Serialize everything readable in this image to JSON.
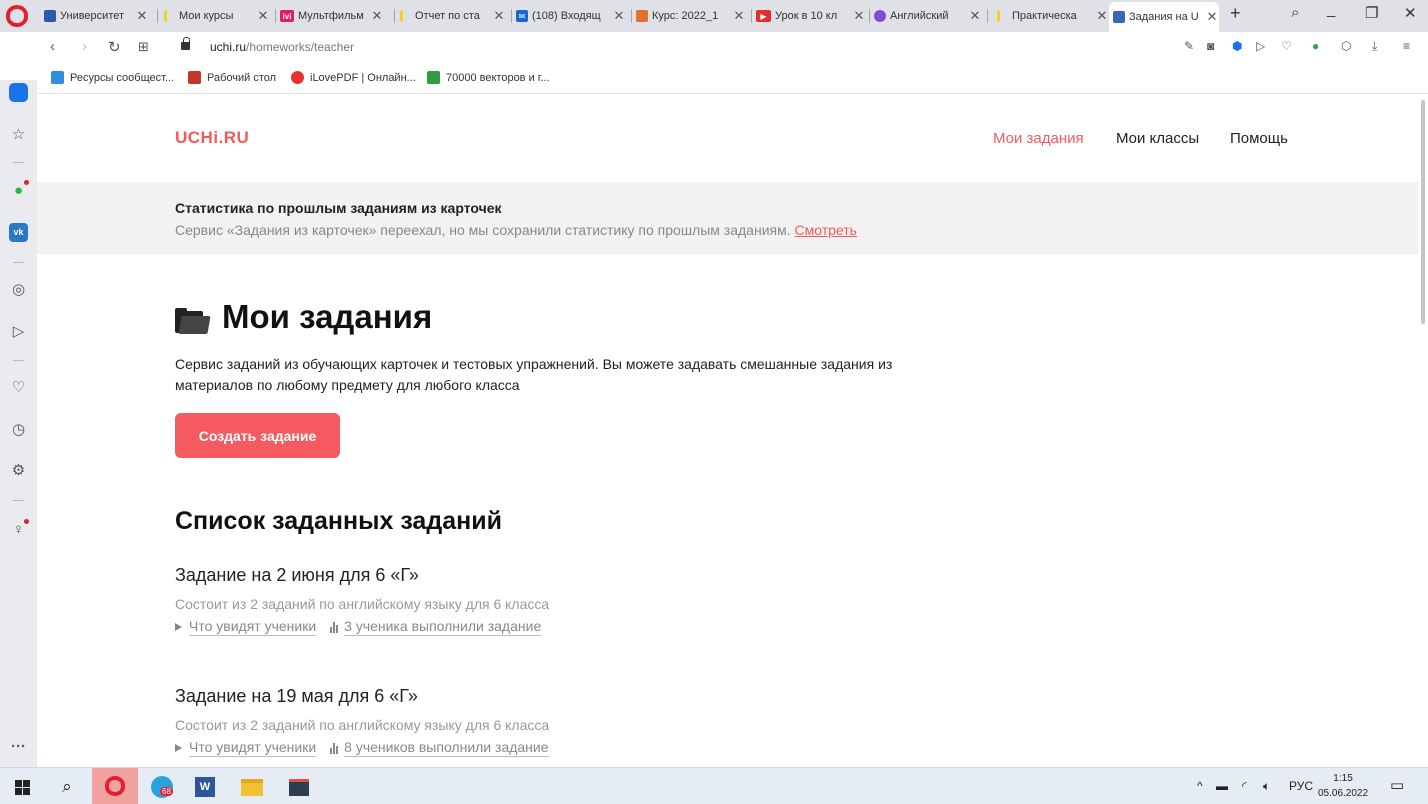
{
  "browser": {
    "tabs": [
      {
        "title": "Университет",
        "color": "#2b5ba8"
      },
      {
        "title": "Мои курсы",
        "color": "#f2d230"
      },
      {
        "title": "Мультфильм",
        "color": "#e31d5b"
      },
      {
        "title": "Отчет по ста",
        "color": "#f2d230"
      },
      {
        "title": "(108) Входящ",
        "color": "#1a66d6"
      },
      {
        "title": "Курс: 2022_1",
        "color": "#e0702c"
      },
      {
        "title": "Урок в 10 кл",
        "color": "#e52d27"
      },
      {
        "title": "Английский",
        "color": "#7d4bd6"
      },
      {
        "title": "Практическа",
        "color": "#f2d230"
      },
      {
        "title": "Задания на U",
        "color": "#3a66b8"
      }
    ],
    "url_host": "uchi.ru",
    "url_path": "/homeworks/teacher",
    "bookmarks": [
      {
        "label": "Ресурсы сообщест...",
        "color": "#2f8fd8"
      },
      {
        "label": "Рабочий стол",
        "color": "#c0392b"
      },
      {
        "label": "iLovePDF | Онлайн...",
        "color": "#e5322d"
      },
      {
        "label": "70000 векторов и г...",
        "color": "#2e9e3e"
      }
    ]
  },
  "site": {
    "logo": "UCHi.RU",
    "nav": {
      "my_tasks": "Мои задания",
      "my_classes": "Мои классы",
      "help": "Помощь"
    },
    "banner": {
      "title": "Статистика по прошлым заданиям из карточек",
      "text": "Сервис «Задания из карточек» переехал, но мы сохранили статистику по прошлым заданиям.",
      "link": "Смотреть"
    },
    "heading": "Мои задания",
    "description": "Сервис заданий из обучающих карточек и тестовых упражнений. Вы можете задавать смешанные задания из материалов по любому предмету для любого класса",
    "create_button": "Создать задание",
    "list_heading": "Список заданных заданий",
    "assignments": [
      {
        "title": "Задание на 2 июня для 6 «Г»",
        "subtitle": "Состоит из 2 заданий по английскому языку для 6 класса",
        "preview_link": "Что увидят ученики",
        "stats_link": "3 ученика выполнили задание"
      },
      {
        "title": "Задание на 19 мая для 6 «Г»",
        "subtitle": "Состоит из 2 заданий по английскому языку для 6 класса",
        "preview_link": "Что увидят ученики",
        "stats_link": "8 учеников выполнили задание"
      }
    ]
  },
  "taskbar": {
    "language": "РУС",
    "time": "1:15",
    "date": "05.06.2022",
    "telegram_badge": "68"
  }
}
